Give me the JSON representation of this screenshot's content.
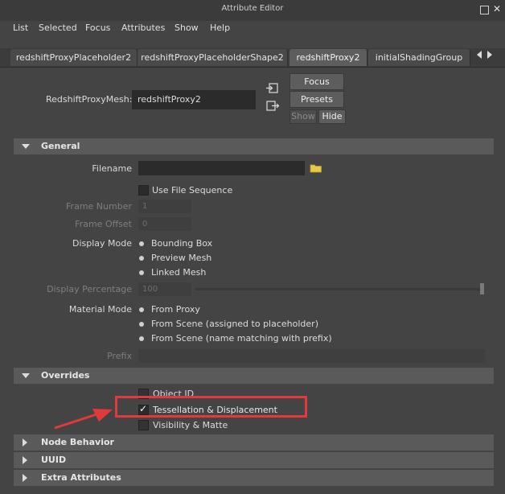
{
  "window": {
    "title": "Attribute Editor"
  },
  "menu": [
    "List",
    "Selected",
    "Focus",
    "Attributes",
    "Show",
    "Help"
  ],
  "tabs": [
    "redshiftProxyPlaceholder2",
    "redshiftProxyPlaceholderShape2",
    "redshiftProxy2",
    "initialShadingGroup"
  ],
  "active_tab": "redshiftProxy2",
  "node": {
    "label": "RedshiftProxyMesh:",
    "value": "redshiftProxy2"
  },
  "buttons": {
    "focus": "Focus",
    "presets": "Presets",
    "show": "Show",
    "hide": "Hide"
  },
  "sections": {
    "general": "General",
    "overrides": "Overrides",
    "node_behavior": "Node Behavior",
    "uuid": "UUID",
    "extra": "Extra Attributes"
  },
  "general": {
    "filename_label": "Filename",
    "filename_value": "",
    "use_file_sequence": "Use File Sequence",
    "frame_number_label": "Frame Number",
    "frame_number_value": "1",
    "frame_offset_label": "Frame Offset",
    "frame_offset_value": "0",
    "display_mode_label": "Display Mode",
    "display_modes": [
      "Bounding Box",
      "Preview Mesh",
      "Linked Mesh"
    ],
    "display_percentage_label": "Display Percentage",
    "display_percentage_value": "100",
    "material_mode_label": "Material Mode",
    "material_modes": [
      "From Proxy",
      "From Scene (assigned to placeholder)",
      "From Scene (name matching with prefix)"
    ],
    "prefix_label": "Prefix",
    "prefix_value": ""
  },
  "overrides": {
    "object_id": "Object ID",
    "tessellation": "Tessellation & Displacement",
    "visibility": "Visibility & Matte"
  },
  "annotation": {
    "highlight_color": "#e03a3a"
  },
  "icons": [
    "folder-icon",
    "select-input-icon",
    "select-output-icon"
  ]
}
